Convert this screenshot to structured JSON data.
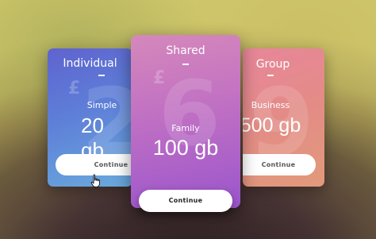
{
  "plans": [
    {
      "title": "Individual",
      "subtitle": "Simple",
      "amount": "20 gb",
      "bg_digit": "2",
      "currency": "£",
      "button": "Continue"
    },
    {
      "title": "Shared",
      "subtitle": "Family",
      "amount": "100 gb",
      "bg_digit": "6",
      "currency": "£",
      "button": "Continue"
    },
    {
      "title": "Group",
      "subtitle": "Business",
      "amount": "500 gb",
      "bg_digit": "9",
      "currency": "£",
      "button": "Continue"
    }
  ],
  "colors": {
    "individual": "#5e7fd8",
    "shared": "#c070c3",
    "group": "#e38c86",
    "button_text": "#555555"
  }
}
